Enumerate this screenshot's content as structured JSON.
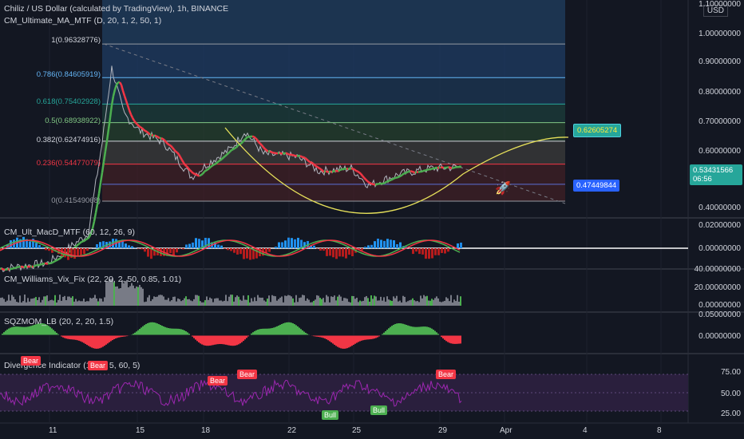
{
  "title": "Chiliz / US Dollar (calculated by TradingView), 1h, BINANCE",
  "indicator_main": "CM_Ultimate_MA_MTF (D, 20, 1, 2, 50, 1)",
  "currency": "USD",
  "fib_levels": [
    {
      "label": "1(0.96328776)",
      "value": 0.96328776,
      "color": "#9598a1"
    },
    {
      "label": "0.786(0.84605919)",
      "value": 0.84605919,
      "color": "#64b5f6"
    },
    {
      "label": "0.618(0.75402928)",
      "value": 0.75402928,
      "color": "#26a69a"
    },
    {
      "label": "0.5(0.68938922)",
      "value": 0.68938922,
      "color": "#81c784"
    },
    {
      "label": "0.382(0.62474916)",
      "value": 0.62474916,
      "color": "#d1d4dc"
    },
    {
      "label": "0.236(0.54477079)",
      "value": 0.54477079,
      "color": "#f23645"
    },
    {
      "label": "0(0.41549068)",
      "value": 0.41549068,
      "color": "#9598a1"
    }
  ],
  "price_axis": [
    "1.10000000",
    "1.00000000",
    "0.90000000",
    "0.80000000",
    "0.70000000",
    "0.60000000",
    "0.40000000"
  ],
  "price_labels": {
    "current": "0.53431566",
    "countdown": "06:56",
    "target": "0.62605274",
    "support": "0.47449844"
  },
  "panes": {
    "macd": {
      "title": "CM_Ult_MacD_MTF (60, 12, 26, 9)",
      "axis": [
        "0.02000000",
        "0.00000000"
      ]
    },
    "vix": {
      "title": "CM_Williams_Vix_Fix (22, 20, 2, 50, 0.85, 1.01)",
      "axis": [
        "40.00000000",
        "20.00000000",
        "0.00000000"
      ]
    },
    "sqz": {
      "title": "SQZMOM_LB (20, 2, 20, 1.5)",
      "axis": [
        "0.05000000",
        "0.00000000"
      ]
    },
    "div": {
      "title": "Divergence Indicator (14, 5, 5, 60, 5)",
      "axis": [
        "75.00",
        "50.00",
        "25.00"
      ]
    }
  },
  "div_tags": [
    {
      "text": "Bear",
      "kind": "bear"
    },
    {
      "text": "Bear",
      "kind": "bear"
    },
    {
      "text": "Bear",
      "kind": "bear"
    },
    {
      "text": "Bear",
      "kind": "bear"
    },
    {
      "text": "Bear",
      "kind": "bear"
    },
    {
      "text": "Bull",
      "kind": "bull"
    },
    {
      "text": "Bull",
      "kind": "bull"
    }
  ],
  "x_ticks": [
    "11",
    "15",
    "18",
    "22",
    "25",
    "29",
    "Apr",
    "4",
    "8"
  ],
  "colors": {
    "bg": "#131722",
    "bear": "#f23645",
    "bull": "#4caf50",
    "curve": "#e6e05a",
    "rsi": "#9c27b0",
    "target_bg": "#26a69a",
    "support_bg": "#2962ff",
    "current_bg": "#26a69a"
  }
}
